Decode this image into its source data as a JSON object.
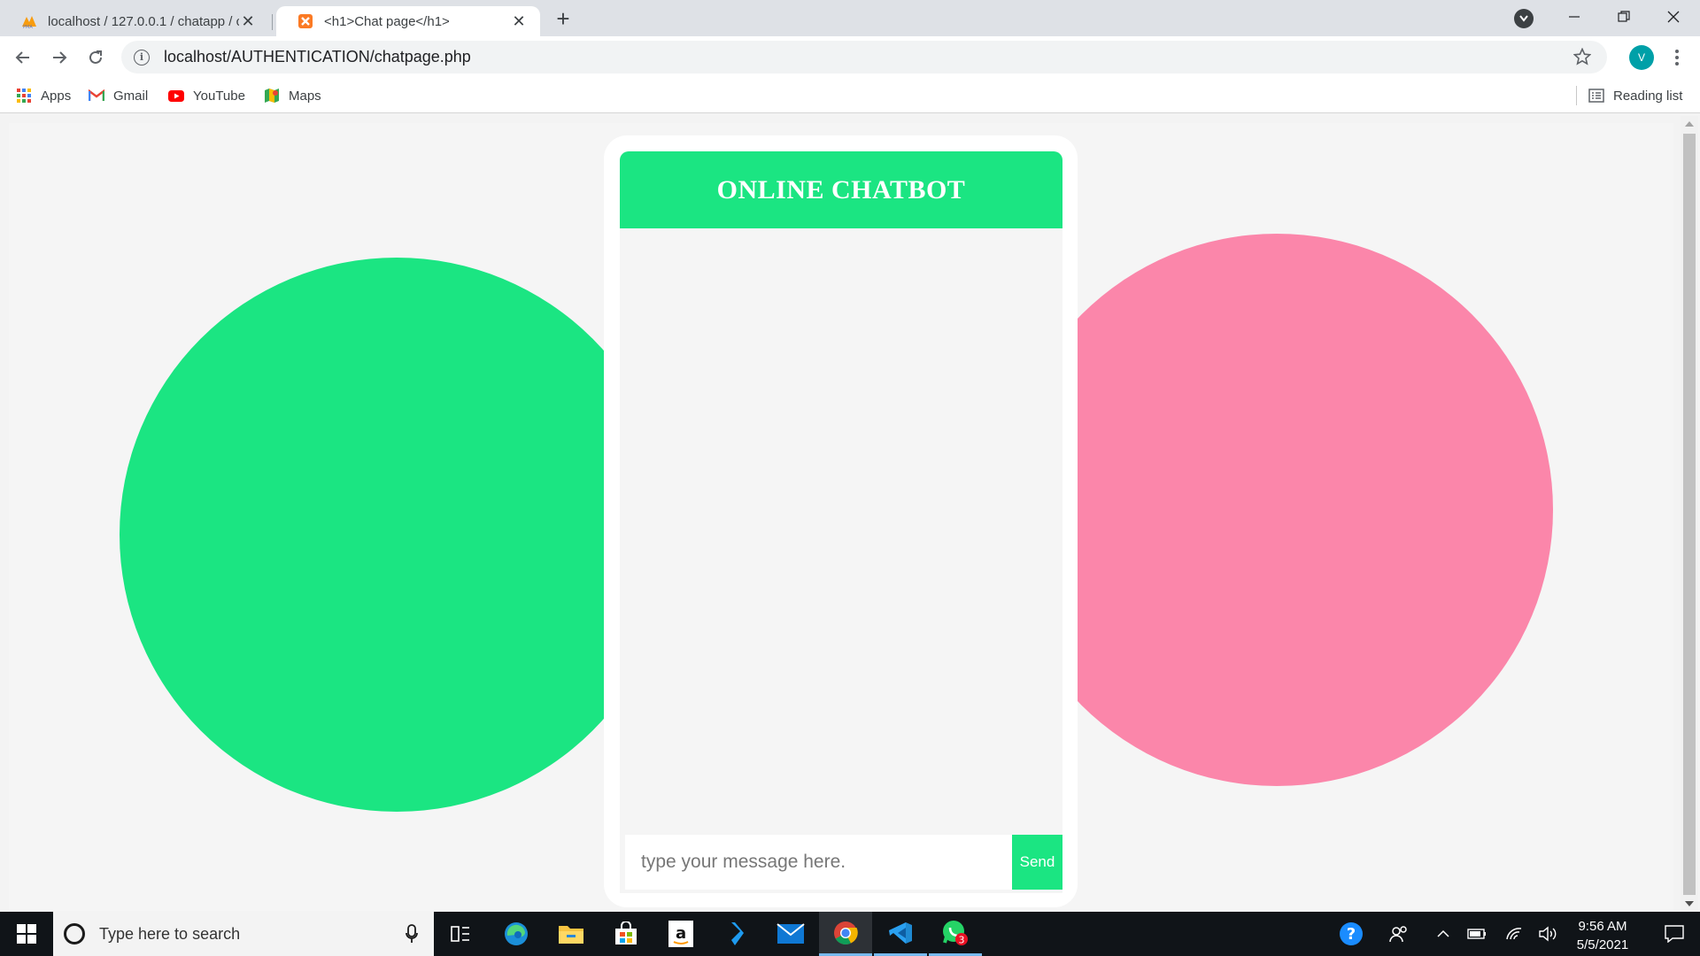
{
  "browser": {
    "tabs": [
      {
        "title": "localhost / 127.0.0.1 / chatapp / c",
        "icon": "phpmyadmin-icon",
        "active": false
      },
      {
        "title": "<h1>Chat page</h1>",
        "icon": "xampp-icon",
        "active": true
      }
    ],
    "address": "localhost/AUTHENTICATION/chatpage.php",
    "profile_initial": "V",
    "bookmarks": [
      {
        "label": "Apps",
        "icon": "apps-grid-icon"
      },
      {
        "label": "Gmail",
        "icon": "gmail-icon"
      },
      {
        "label": "YouTube",
        "icon": "youtube-icon"
      },
      {
        "label": "Maps",
        "icon": "maps-icon"
      }
    ],
    "reading_list": "Reading list"
  },
  "page": {
    "chat": {
      "title": "ONLINE CHATBOT",
      "input_placeholder": "type your message here.",
      "send_label": "Send"
    },
    "colors": {
      "accent_green": "#1be582",
      "accent_pink": "#fb86aa",
      "background": "#f5f5f5"
    }
  },
  "taskbar": {
    "search_placeholder": "Type here to search",
    "apps": [
      "task-view",
      "edge",
      "file-explorer",
      "store",
      "amazon",
      "visual-studio",
      "mail",
      "chrome",
      "vscode",
      "whatsapp"
    ],
    "whatsapp_badge": "3",
    "time": "9:56 AM",
    "date": "5/5/2021"
  }
}
